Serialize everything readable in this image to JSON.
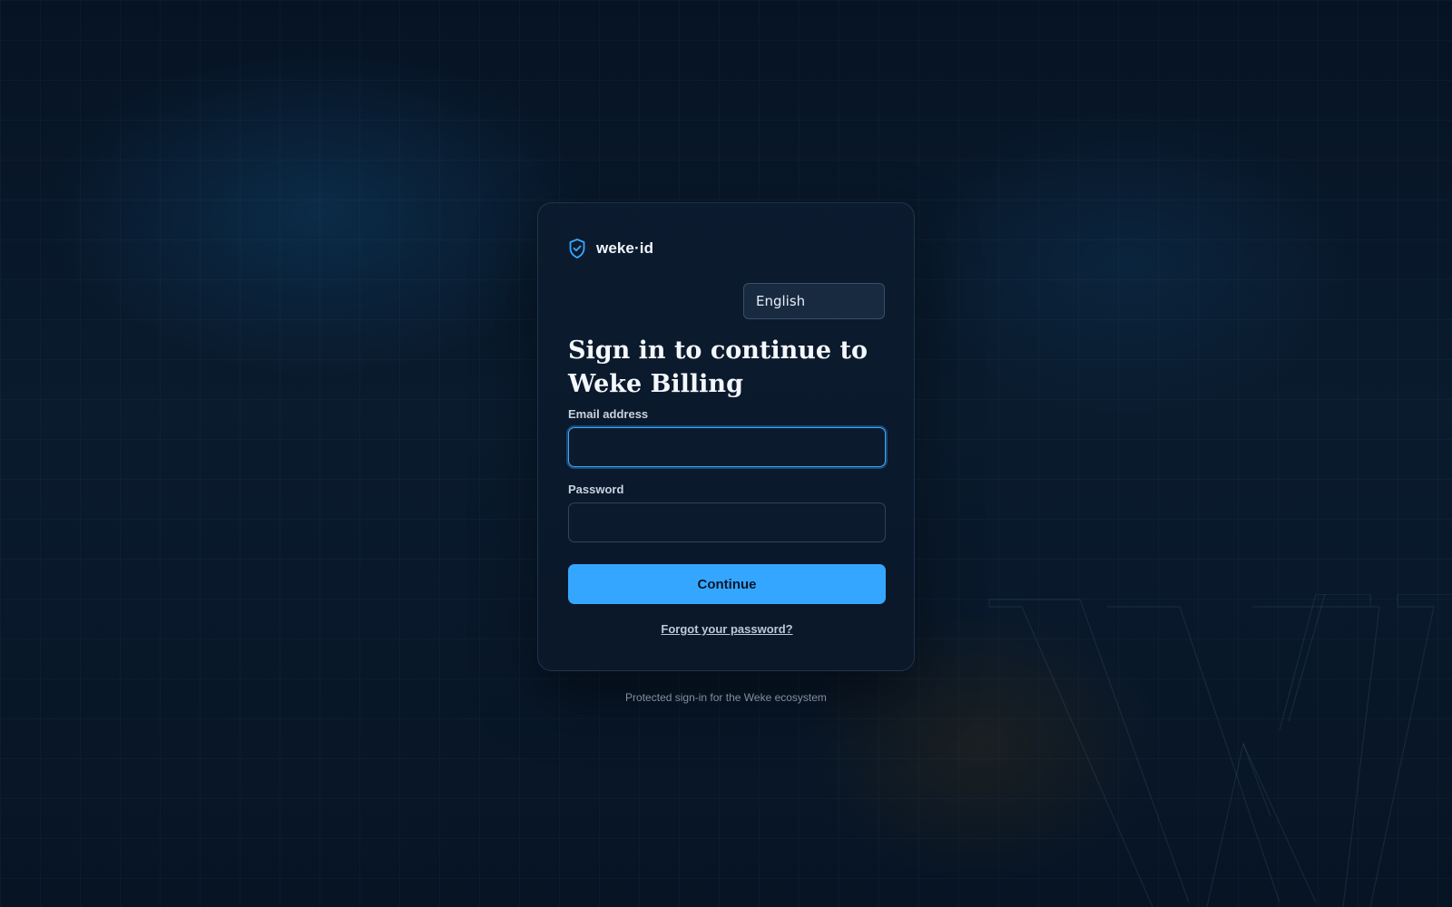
{
  "brand": {
    "icon": "shield-check-icon",
    "name": "weke·id"
  },
  "language_select": {
    "selected": "English"
  },
  "title": "Sign in to continue to Weke Billing",
  "form": {
    "email_label": "Email address",
    "email_value": "",
    "password_label": "Password",
    "password_value": "",
    "submit_label": "Continue",
    "forgot_link": "Forgot your password?"
  },
  "footer_note": "Protected sign-in for the Weke ecosystem",
  "colors": {
    "accent": "#35a6ff",
    "background": "#071424",
    "card": "#0c1b2e"
  }
}
